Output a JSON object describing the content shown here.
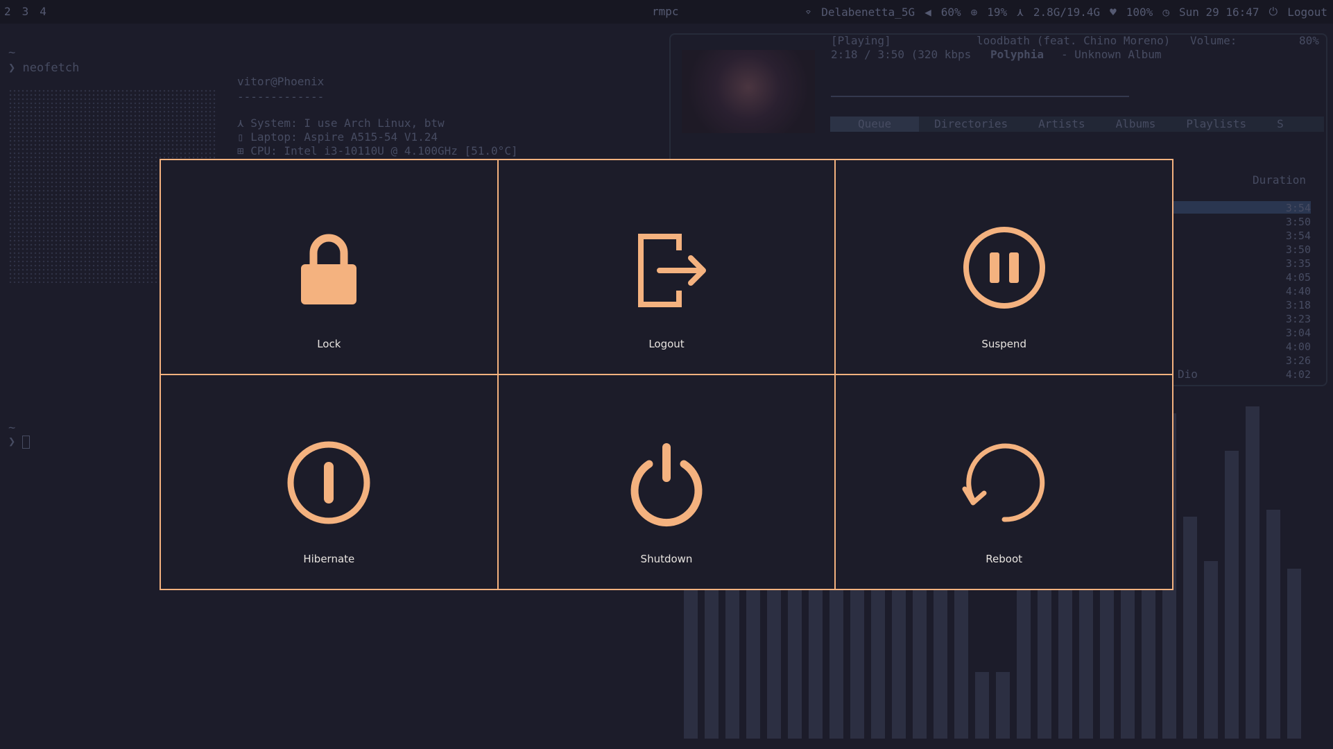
{
  "topbar": {
    "workspaces": [
      "2",
      "3",
      "4"
    ],
    "center_title": "rmpc",
    "wifi": "Delabenetta_5G",
    "volume": "60%",
    "cpu": "19%",
    "memory": "2.8G/19.4G",
    "battery": "100%",
    "clock": "Sun 29 16:47",
    "logout": "Logout"
  },
  "terminal": {
    "prompt_tilde": "~",
    "prompt_cmd": "❯ neofetch",
    "user_host": "vitor@Phoenix",
    "separator": "-------------",
    "system": "System: I use Arch Linux, btw",
    "laptop": "Laptop: Aspire A515-54 V1.24",
    "cpu": "CPU: Intel i3-10110U @ 4.100GHz [51.0°C]",
    "prompt2_tilde": "~",
    "prompt2": "❯ "
  },
  "player": {
    "state": "[Playing]",
    "track": "loodbath (feat. Chino Moreno)",
    "volume_label": "Volume:",
    "volume_value": "80%",
    "time": "2:18 / 3:50 (320 kbps",
    "artist": "Polyphia",
    "album": "- Unknown Album",
    "tabs": [
      "Queue",
      "Directories",
      "Artists",
      "Albums",
      "Playlists",
      "S"
    ],
    "duration_header": "Duration",
    "durations": [
      "3:54",
      "3:50",
      "3:54",
      "3:50",
      "3:35",
      "4:05",
      "4:40",
      "3:18",
      "3:23",
      "3:04",
      "4:00",
      "3:26",
      "4:02"
    ],
    "side_label": "Dio",
    "visualizer_levels": [
      0.33,
      0.3,
      0.43,
      0.41,
      0.36,
      0.3,
      0.42,
      0.39,
      0.31,
      0.31,
      0.26,
      0.42,
      0.42,
      0.27,
      0.09,
      0.09,
      0.27,
      0.26,
      0.42,
      0.33,
      0.35,
      0.3,
      0.32,
      0.44,
      0.3,
      0.24,
      0.39,
      0.45,
      0.31,
      0.23
    ]
  },
  "menu": {
    "colors": {
      "accent": "#f4b27f",
      "background": "#1c1c29",
      "label": "#e8e4e0"
    },
    "items": [
      {
        "label": "Lock",
        "icon": "lock-icon"
      },
      {
        "label": "Logout",
        "icon": "logout-icon"
      },
      {
        "label": "Suspend",
        "icon": "pause-circle-icon"
      },
      {
        "label": "Hibernate",
        "icon": "hibernate-icon"
      },
      {
        "label": "Shutdown",
        "icon": "power-icon"
      },
      {
        "label": "Reboot",
        "icon": "reboot-icon"
      }
    ]
  }
}
